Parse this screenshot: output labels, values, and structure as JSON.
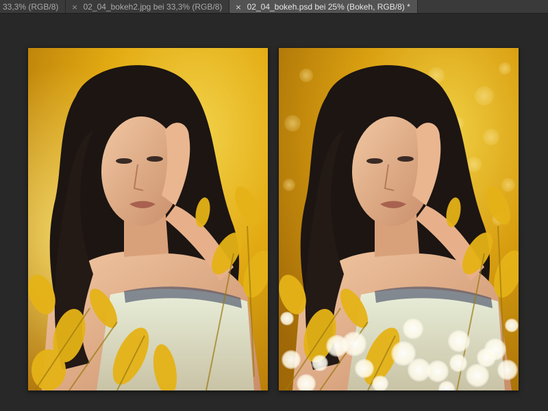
{
  "tabs": [
    {
      "label": "33,3% (RGB/8)",
      "has_close": false,
      "active": false
    },
    {
      "label": "02_04_bokeh2.jpg bei 33,3% (RGB/8)",
      "has_close": true,
      "active": false
    },
    {
      "label": "02_04_bokeh.psd bei 25% (Bokeh, RGB/8) *",
      "has_close": true,
      "active": true
    }
  ],
  "close_glyph": "×",
  "canvas": {
    "background": "#282828",
    "images": [
      {
        "name": "original-photo",
        "bokeh": false
      },
      {
        "name": "bokeh-photo",
        "bokeh": true
      }
    ]
  },
  "colors": {
    "tabbar": "#3a3a3a",
    "active_tab": "#535353",
    "workspace": "#282828",
    "yellow": "#e8b10e"
  }
}
